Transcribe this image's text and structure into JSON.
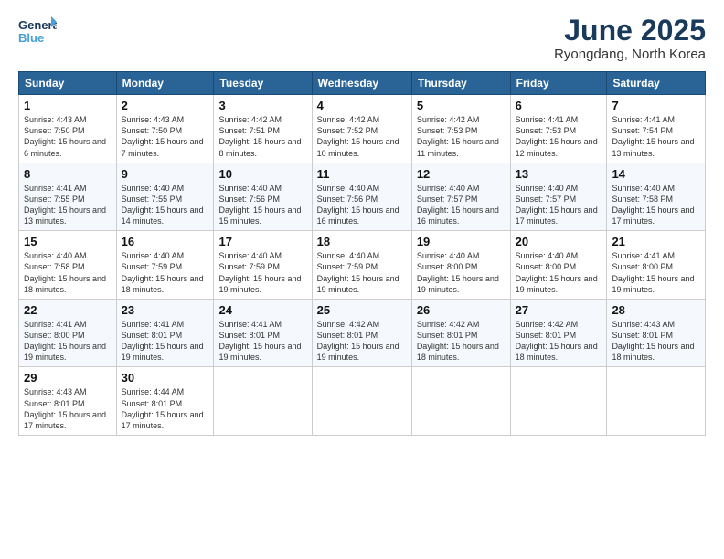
{
  "logo": {
    "line1": "General",
    "line2": "Blue"
  },
  "title": "June 2025",
  "location": "Ryongdang, North Korea",
  "days_header": [
    "Sunday",
    "Monday",
    "Tuesday",
    "Wednesday",
    "Thursday",
    "Friday",
    "Saturday"
  ],
  "weeks": [
    [
      {
        "day": "1",
        "sunrise": "4:43 AM",
        "sunset": "7:50 PM",
        "daylight": "15 hours and 6 minutes."
      },
      {
        "day": "2",
        "sunrise": "4:43 AM",
        "sunset": "7:50 PM",
        "daylight": "15 hours and 7 minutes."
      },
      {
        "day": "3",
        "sunrise": "4:42 AM",
        "sunset": "7:51 PM",
        "daylight": "15 hours and 8 minutes."
      },
      {
        "day": "4",
        "sunrise": "4:42 AM",
        "sunset": "7:52 PM",
        "daylight": "15 hours and 10 minutes."
      },
      {
        "day": "5",
        "sunrise": "4:42 AM",
        "sunset": "7:53 PM",
        "daylight": "15 hours and 11 minutes."
      },
      {
        "day": "6",
        "sunrise": "4:41 AM",
        "sunset": "7:53 PM",
        "daylight": "15 hours and 12 minutes."
      },
      {
        "day": "7",
        "sunrise": "4:41 AM",
        "sunset": "7:54 PM",
        "daylight": "15 hours and 13 minutes."
      }
    ],
    [
      {
        "day": "8",
        "sunrise": "4:41 AM",
        "sunset": "7:55 PM",
        "daylight": "15 hours and 13 minutes."
      },
      {
        "day": "9",
        "sunrise": "4:40 AM",
        "sunset": "7:55 PM",
        "daylight": "15 hours and 14 minutes."
      },
      {
        "day": "10",
        "sunrise": "4:40 AM",
        "sunset": "7:56 PM",
        "daylight": "15 hours and 15 minutes."
      },
      {
        "day": "11",
        "sunrise": "4:40 AM",
        "sunset": "7:56 PM",
        "daylight": "15 hours and 16 minutes."
      },
      {
        "day": "12",
        "sunrise": "4:40 AM",
        "sunset": "7:57 PM",
        "daylight": "15 hours and 16 minutes."
      },
      {
        "day": "13",
        "sunrise": "4:40 AM",
        "sunset": "7:57 PM",
        "daylight": "15 hours and 17 minutes."
      },
      {
        "day": "14",
        "sunrise": "4:40 AM",
        "sunset": "7:58 PM",
        "daylight": "15 hours and 17 minutes."
      }
    ],
    [
      {
        "day": "15",
        "sunrise": "4:40 AM",
        "sunset": "7:58 PM",
        "daylight": "15 hours and 18 minutes."
      },
      {
        "day": "16",
        "sunrise": "4:40 AM",
        "sunset": "7:59 PM",
        "daylight": "15 hours and 18 minutes."
      },
      {
        "day": "17",
        "sunrise": "4:40 AM",
        "sunset": "7:59 PM",
        "daylight": "15 hours and 19 minutes."
      },
      {
        "day": "18",
        "sunrise": "4:40 AM",
        "sunset": "7:59 PM",
        "daylight": "15 hours and 19 minutes."
      },
      {
        "day": "19",
        "sunrise": "4:40 AM",
        "sunset": "8:00 PM",
        "daylight": "15 hours and 19 minutes."
      },
      {
        "day": "20",
        "sunrise": "4:40 AM",
        "sunset": "8:00 PM",
        "daylight": "15 hours and 19 minutes."
      },
      {
        "day": "21",
        "sunrise": "4:41 AM",
        "sunset": "8:00 PM",
        "daylight": "15 hours and 19 minutes."
      }
    ],
    [
      {
        "day": "22",
        "sunrise": "4:41 AM",
        "sunset": "8:00 PM",
        "daylight": "15 hours and 19 minutes."
      },
      {
        "day": "23",
        "sunrise": "4:41 AM",
        "sunset": "8:01 PM",
        "daylight": "15 hours and 19 minutes."
      },
      {
        "day": "24",
        "sunrise": "4:41 AM",
        "sunset": "8:01 PM",
        "daylight": "15 hours and 19 minutes."
      },
      {
        "day": "25",
        "sunrise": "4:42 AM",
        "sunset": "8:01 PM",
        "daylight": "15 hours and 19 minutes."
      },
      {
        "day": "26",
        "sunrise": "4:42 AM",
        "sunset": "8:01 PM",
        "daylight": "15 hours and 18 minutes."
      },
      {
        "day": "27",
        "sunrise": "4:42 AM",
        "sunset": "8:01 PM",
        "daylight": "15 hours and 18 minutes."
      },
      {
        "day": "28",
        "sunrise": "4:43 AM",
        "sunset": "8:01 PM",
        "daylight": "15 hours and 18 minutes."
      }
    ],
    [
      {
        "day": "29",
        "sunrise": "4:43 AM",
        "sunset": "8:01 PM",
        "daylight": "15 hours and 17 minutes."
      },
      {
        "day": "30",
        "sunrise": "4:44 AM",
        "sunset": "8:01 PM",
        "daylight": "15 hours and 17 minutes."
      },
      null,
      null,
      null,
      null,
      null
    ]
  ],
  "cell_labels": {
    "sunrise": "Sunrise: ",
    "sunset": "Sunset: ",
    "daylight": "Daylight: "
  }
}
